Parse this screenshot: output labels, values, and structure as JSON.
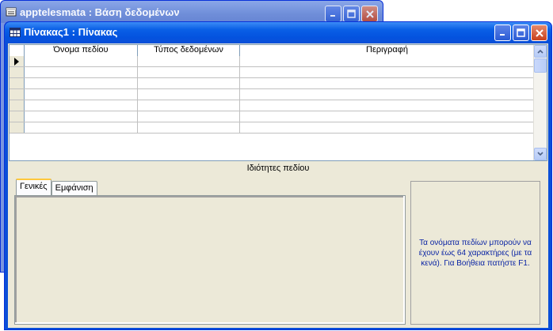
{
  "bg_window": {
    "title": "apptelesmata : Βάση δεδομένων"
  },
  "main_window": {
    "title": "Πίνακας1 : Πίνακας",
    "icon": "table-icon"
  },
  "grid": {
    "columns": [
      "Όνομα πεδίου",
      "Τύπος δεδομένων",
      "Περιγραφή"
    ],
    "current_row_indicator": "arrow-right-icon",
    "row_count": 7
  },
  "properties": {
    "section_label": "Ιδιότητες πεδίου",
    "tabs": [
      "Γενικές",
      "Εμφάνιση"
    ],
    "active_tab": "Γενικές",
    "help_text": "Τα ονόματα πεδίων μπορούν να έχουν έως 64 χαρακτήρες (με τα κενά). Για Βοήθεια πατήστε F1."
  },
  "colors": {
    "titlebar": "#0a5fe6",
    "client_bg": "#ece9d8",
    "help_text": "#0a24a4"
  }
}
